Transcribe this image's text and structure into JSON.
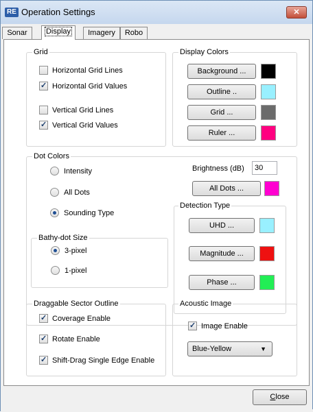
{
  "window": {
    "title": "Operation Settings",
    "app_icon": "RE",
    "close_glyph": "✕"
  },
  "tabs": [
    {
      "label": "Sonar"
    },
    {
      "label": "Display"
    },
    {
      "label": "Imagery"
    },
    {
      "label": "Robo"
    }
  ],
  "active_tab": "Display",
  "grid": {
    "label": "Grid",
    "items": [
      {
        "label": "Horizontal Grid Lines",
        "checked": false
      },
      {
        "label": "Horizontal Grid Values",
        "checked": true
      },
      {
        "label": "Vertical Grid Lines",
        "checked": false
      },
      {
        "label": "Vertical Grid Values",
        "checked": true
      }
    ]
  },
  "display_colors": {
    "label": "Display Colors",
    "items": [
      {
        "label": "Background ...",
        "color": "#000000"
      },
      {
        "label": "Outline ..",
        "color": "#99f0ff"
      },
      {
        "label": "Grid ...",
        "color": "#6b6b6b"
      },
      {
        "label": "Ruler ...",
        "color": "#ff0080"
      }
    ]
  },
  "dot_colors": {
    "label": "Dot Colors",
    "options": [
      {
        "label": "Intensity",
        "checked": false
      },
      {
        "label": "All Dots",
        "checked": false
      },
      {
        "label": "Sounding Type",
        "checked": true
      }
    ],
    "brightness_label": "Brightness (dB)",
    "brightness_value": "30",
    "all_dots_label": "All Dots ...",
    "all_dots_color": "#ff00d0"
  },
  "bathy": {
    "label": "Bathy-dot Size",
    "options": [
      {
        "label": "3-pixel",
        "checked": true
      },
      {
        "label": "1-pixel",
        "checked": false
      }
    ]
  },
  "detection": {
    "label": "Detection Type",
    "items": [
      {
        "label": "UHD ...",
        "color": "#99f0ff"
      },
      {
        "label": "Magnitude ...",
        "color": "#ee1111"
      },
      {
        "label": "Phase ...",
        "color": "#22ee55"
      }
    ]
  },
  "sector": {
    "label": "Draggable Sector Outline",
    "items": [
      {
        "label": "Coverage Enable",
        "checked": true
      },
      {
        "label": "Rotate Enable",
        "checked": true
      },
      {
        "label": "Shift-Drag Single Edge Enable",
        "checked": true
      }
    ]
  },
  "acoustic": {
    "label": "Acoustic Image",
    "enable_label": "Image Enable",
    "enable_checked": true,
    "palette_value": "Blue-Yellow"
  },
  "footer": {
    "close_mnemonic": "C",
    "close_rest": "lose"
  }
}
